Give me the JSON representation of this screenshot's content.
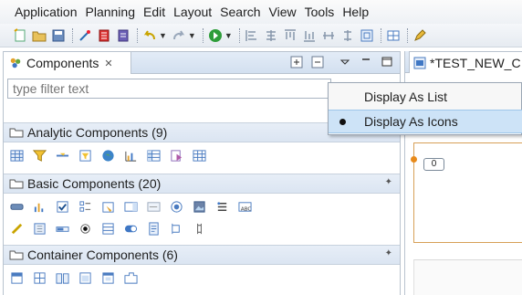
{
  "menu": [
    "Application",
    "Planning",
    "Edit",
    "Layout",
    "Search",
    "View",
    "Tools",
    "Help"
  ],
  "components_tab": {
    "title": "Components",
    "close_glyph": "✕"
  },
  "filter": {
    "placeholder": "type filter text"
  },
  "sections": [
    {
      "label": "Analytic Components (9)",
      "pinned": false
    },
    {
      "label": "Basic Components (20)",
      "pinned": true
    },
    {
      "label": "Container Components (6)",
      "pinned": true
    }
  ],
  "editor": {
    "tab_title": "*TEST_NEW_C",
    "widget_label": "0"
  },
  "view_menu": {
    "items": [
      {
        "label": "Display As List",
        "selected": false
      },
      {
        "label": "Display As Icons",
        "selected": true
      }
    ]
  },
  "colors": {
    "accent": "#cde3f7",
    "canvas_border": "#d7a057",
    "handle": "#e88a1a"
  }
}
